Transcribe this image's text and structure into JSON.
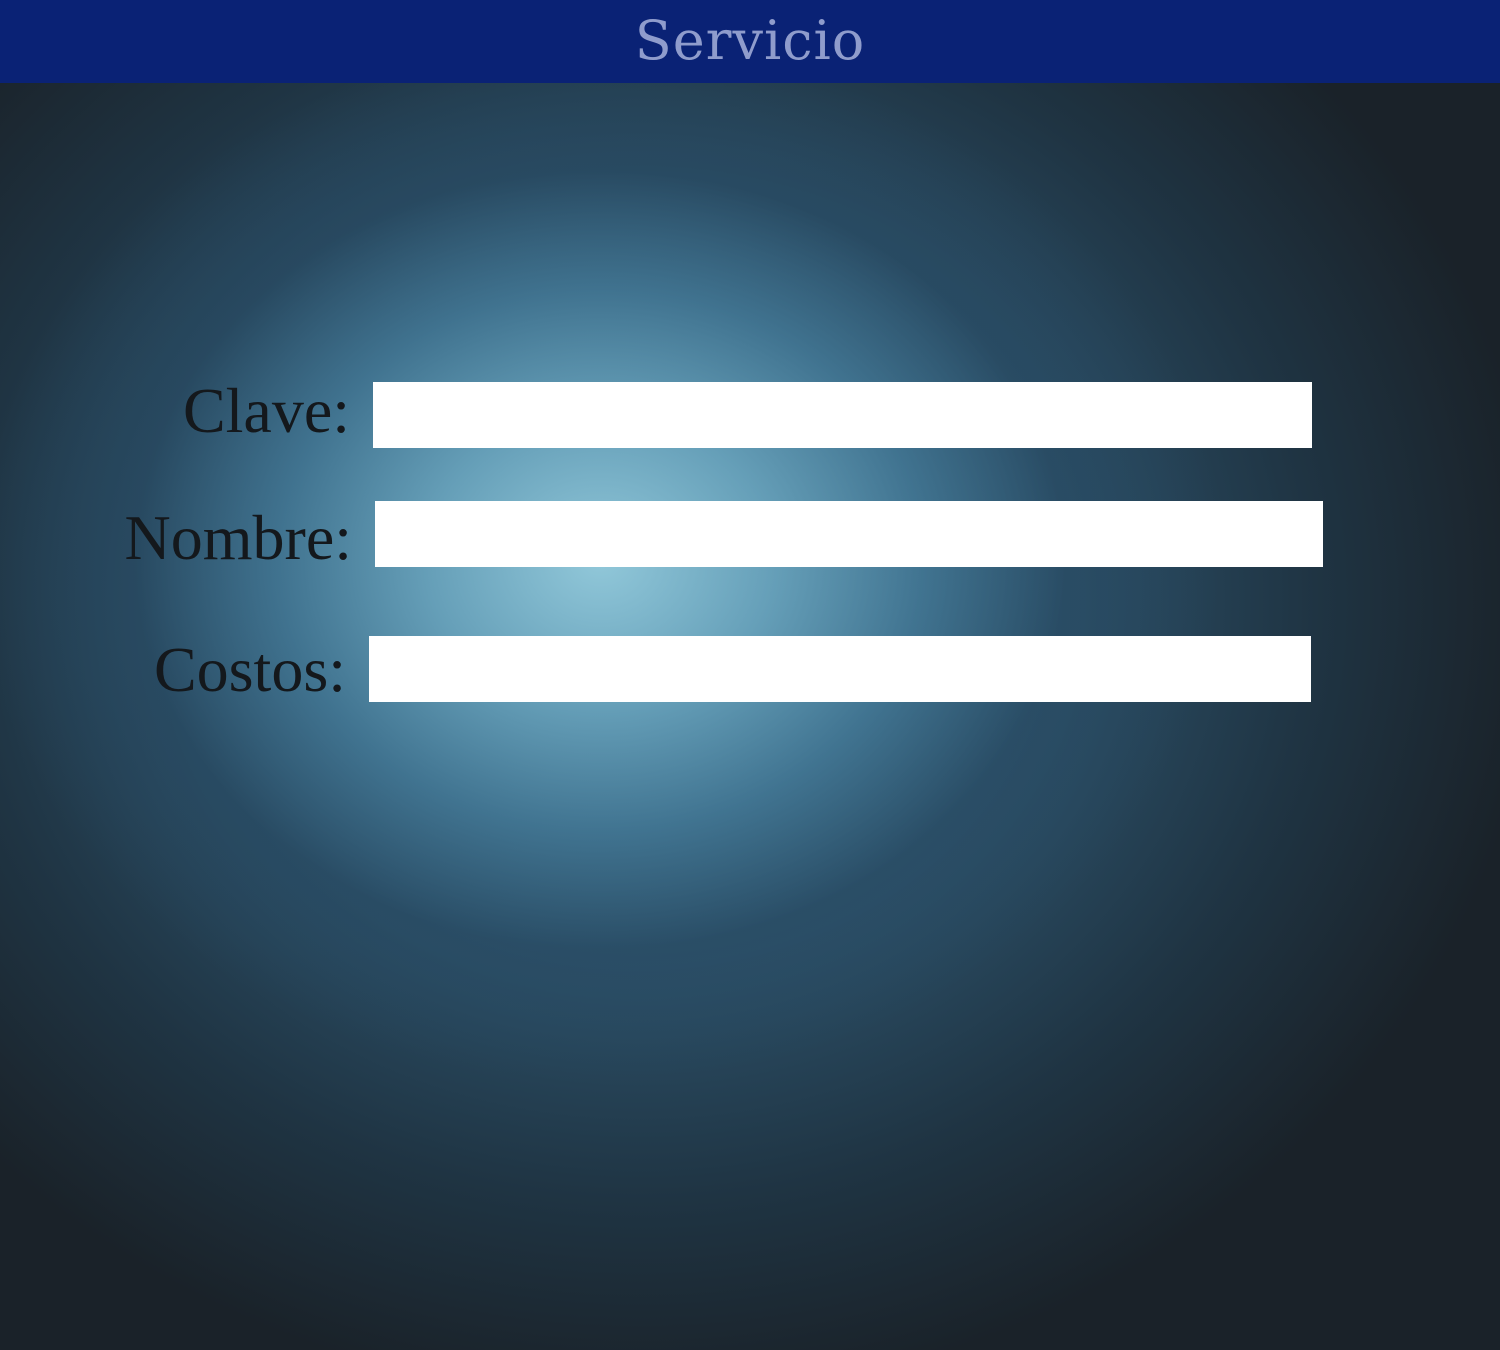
{
  "header": {
    "title": "Servicio"
  },
  "form": {
    "clave": {
      "label": "Clave:",
      "value": ""
    },
    "nombre": {
      "label": "Nombre:",
      "value": ""
    },
    "costos": {
      "label": "Costos:",
      "value": ""
    }
  },
  "colors": {
    "header_background": "#0a2275",
    "header_text": "#8f9ccc",
    "label_text": "#14181c",
    "input_background": "#ffffff"
  }
}
